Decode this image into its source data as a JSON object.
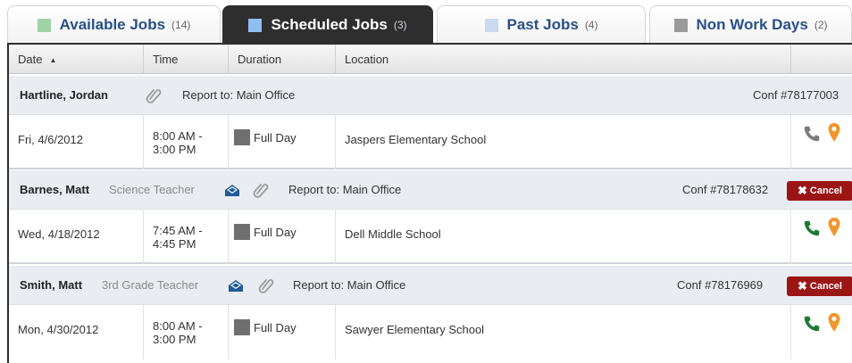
{
  "tabs": [
    {
      "label": "Available Jobs",
      "count": "(14)",
      "swatch": "#9fd3a6"
    },
    {
      "label": "Scheduled Jobs",
      "count": "(3)",
      "swatch": "#8fbff0"
    },
    {
      "label": "Past Jobs",
      "count": "(4)",
      "swatch": "#c8d9f0"
    },
    {
      "label": "Non Work Days",
      "count": "(2)",
      "swatch": "#9a9a9a"
    }
  ],
  "table": {
    "columns": [
      "Date",
      "Time",
      "Duration",
      "Location"
    ],
    "sort_icon": "sort-ascending-icon"
  },
  "jobs": [
    {
      "name": "Hartline, Jordan",
      "role": "",
      "report": "Report to: Main Office",
      "conf": "Conf #78177003",
      "cancel": "",
      "date": "Fri, 4/6/2012",
      "time_start": "8:00 AM -",
      "time_end": "3:00 PM",
      "duration": "Full Day",
      "location": "Jaspers Elementary School",
      "phone_color": "#7a7a7a"
    },
    {
      "name": "Barnes, Matt",
      "role": "Science Teacher",
      "report": "Report to: Main Office",
      "conf": "Conf #78178632",
      "cancel": "Cancel",
      "date": "Wed, 4/18/2012",
      "time_start": "7:45 AM -",
      "time_end": "4:45 PM",
      "duration": "Full Day",
      "location": "Dell Middle School",
      "phone_color": "#1e7a32"
    },
    {
      "name": "Smith, Matt",
      "role": "3rd Grade Teacher",
      "report": "Report to: Main Office",
      "conf": "Conf #78176969",
      "cancel": "Cancel",
      "date": "Mon, 4/30/2012",
      "time_start": "8:00 AM -",
      "time_end": "3:00 PM",
      "duration": "Full Day",
      "location": "Sawyer Elementary School",
      "phone_color": "#1e7a32"
    }
  ],
  "colors": {
    "active_tab": "#2e2e2e",
    "tab_text": "#2a4f88",
    "cancel": "#9c1515",
    "pin": "#f0962a",
    "mail": "#1f5a99"
  }
}
